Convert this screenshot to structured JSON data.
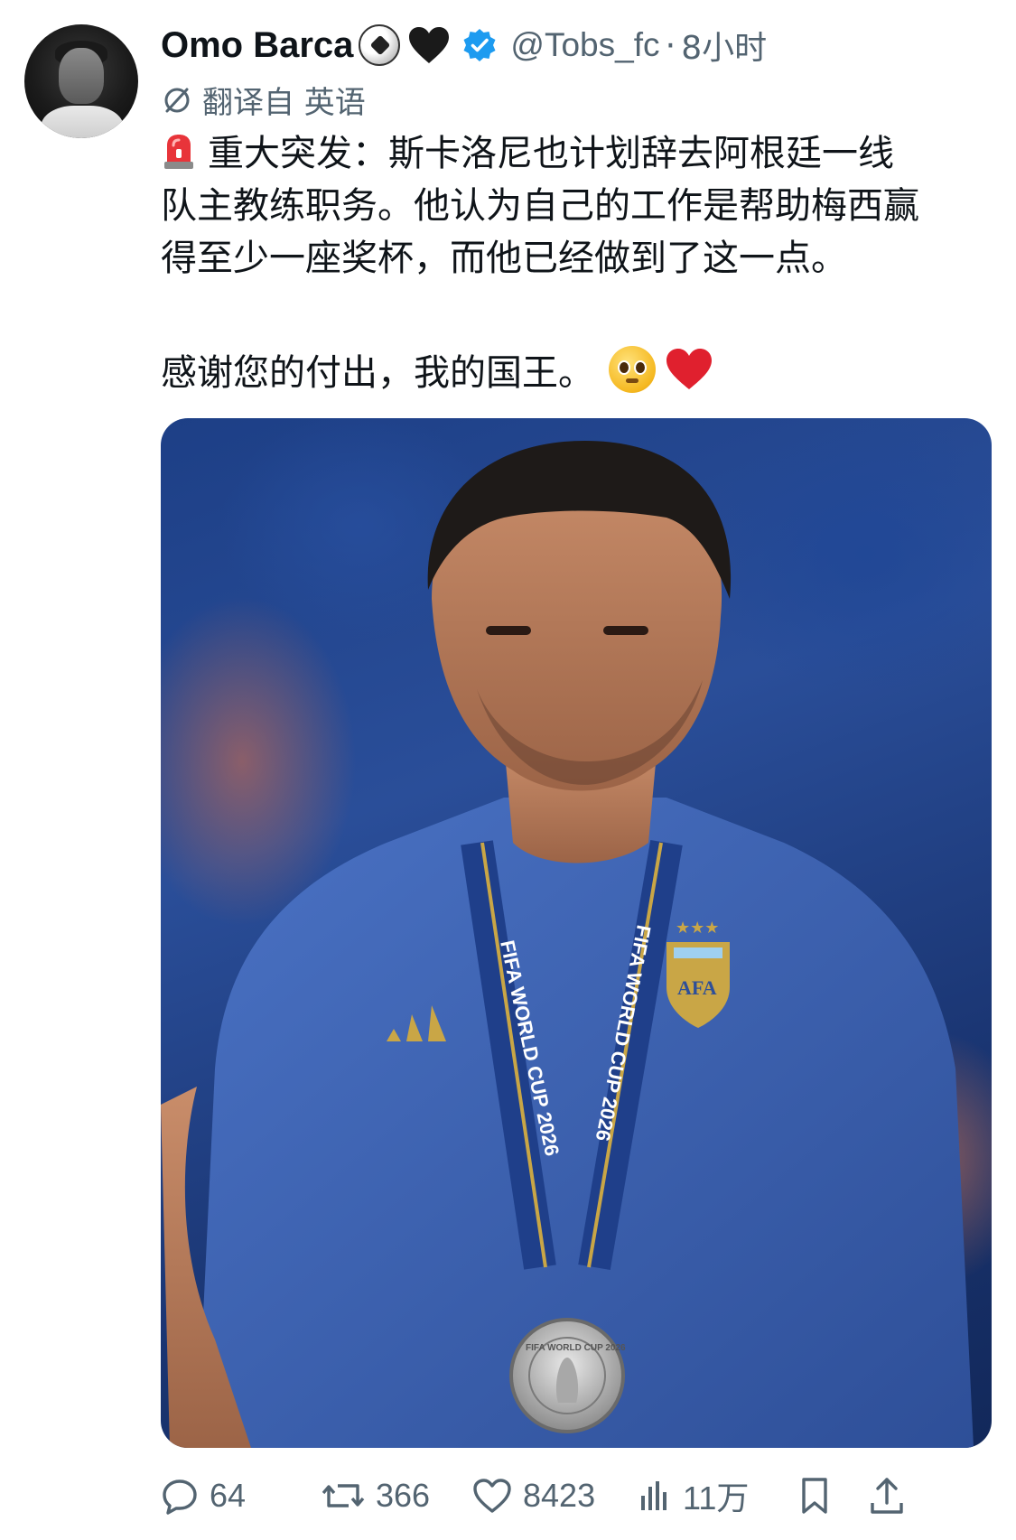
{
  "tweet": {
    "author_name": "Omo Barca",
    "emoji_1": "soccer-ball",
    "emoji_2": "black-heart",
    "verified": true,
    "handle": "@Tobs_fc",
    "separator": "·",
    "time": "8小时",
    "translated_label": "翻译自 英语",
    "text_lines": [
      "重大突发：斯卡洛尼也计划辞去阿根廷一线",
      "队主教练职务。他认为自己的工作是帮助梅西赢",
      "得至少一座奖杯，而他已经做到了这一点。"
    ],
    "text_line_2": "感谢您的付出，我的国王。",
    "media": {
      "lanyard_text": "FIFA WORLD CUP 2026",
      "crest_text": "AFA",
      "medal_text": "FIFA WORLD CUP 2026"
    },
    "actions": {
      "replies": "64",
      "retweets": "366",
      "likes": "8423",
      "views": "11万"
    }
  },
  "colors": {
    "text": "#0f1419",
    "secondary": "#536471",
    "verified": "#1d9bf0",
    "jersey": "#3d63b8",
    "gold": "#c9a646"
  }
}
